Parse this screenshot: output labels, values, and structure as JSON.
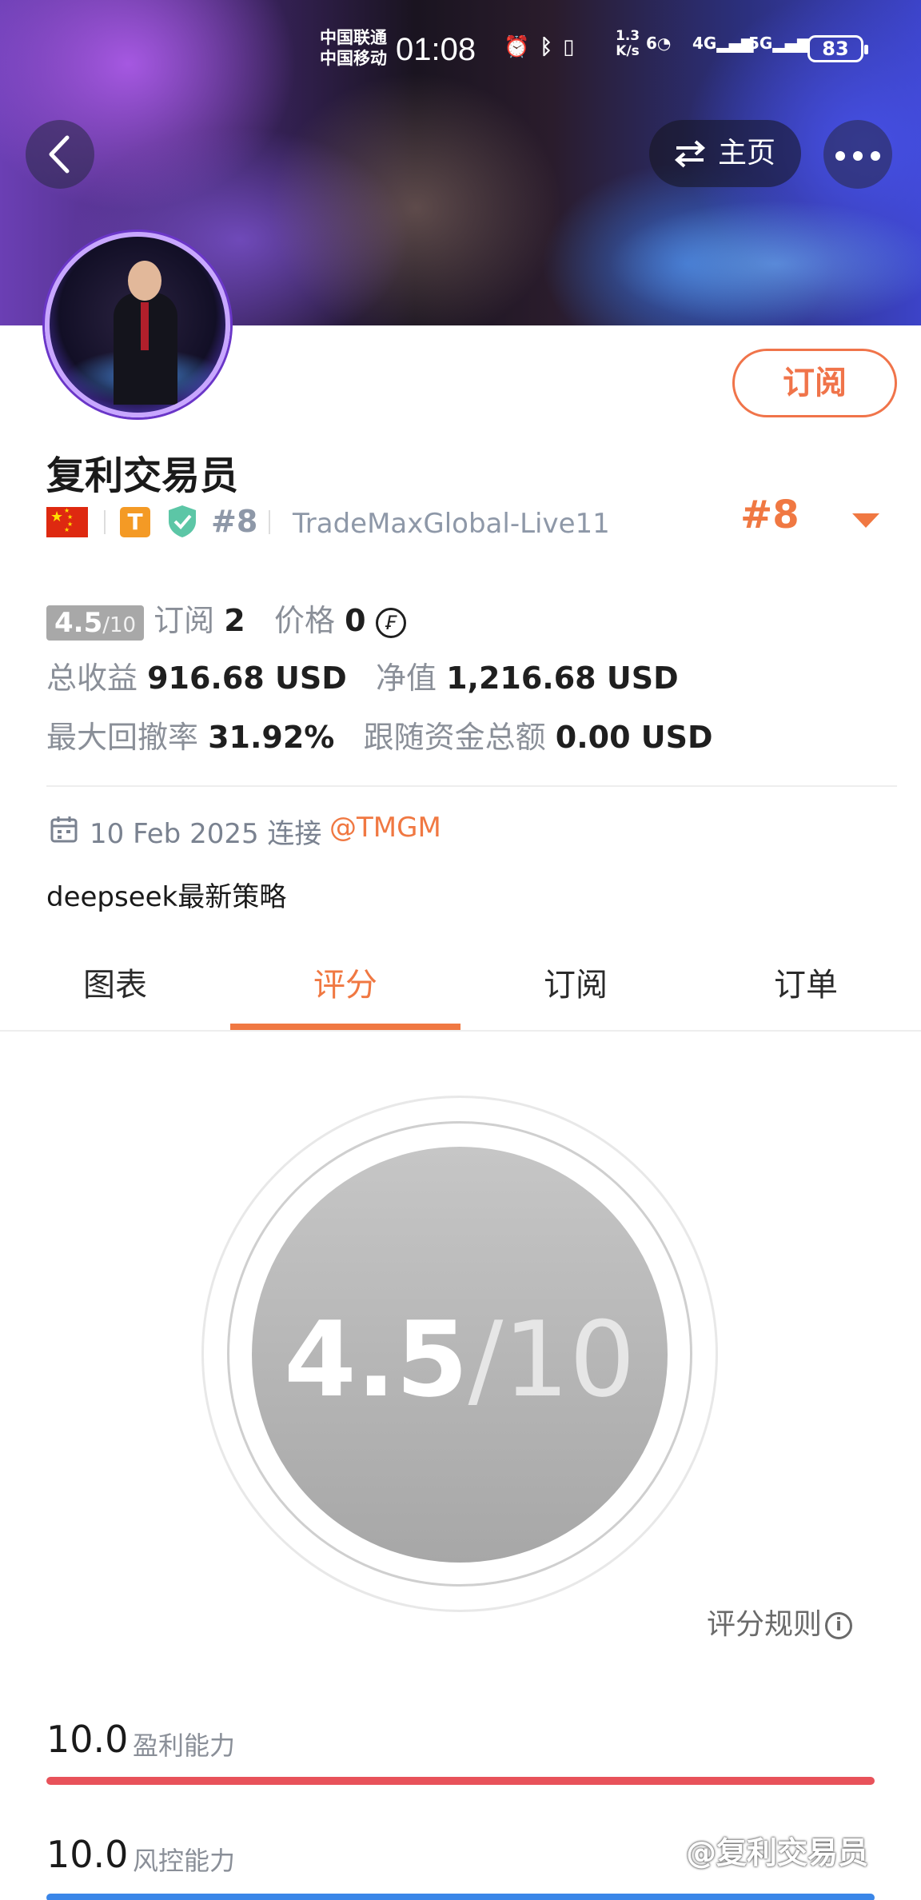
{
  "status_bar": {
    "carrier_1": "中国联通",
    "carrier_2": "中国移动",
    "time": "01:08",
    "speed_value": "1.3",
    "speed_unit": "K/s",
    "wifi_label": "6",
    "net_1": "4G",
    "net_2": "5G",
    "battery": "83"
  },
  "header": {
    "home_label": "主页",
    "subscribe_label": "订阅"
  },
  "profile": {
    "name": "复利交易员",
    "badge_letter": "T",
    "rank_inline": "#8",
    "server": "TradeMaxGlobal-Live11",
    "rank_right": "#8"
  },
  "stats": {
    "score_main": "4.5",
    "score_total": "/10",
    "subscriptions_label": "订阅",
    "subscriptions_value": "2",
    "price_label": "价格",
    "price_value": "0",
    "total_profit_label": "总收益",
    "total_profit_value": "916.68 USD",
    "net_value_label": "净值",
    "net_value_value": "1,216.68 USD",
    "max_drawdown_label": "最大回撤率",
    "max_drawdown_value": "31.92%",
    "follow_funds_label": "跟随资金总额",
    "follow_funds_value": "0.00 USD"
  },
  "connection": {
    "date_text": "10 Feb 2025 连接",
    "broker": "@TMGM"
  },
  "description": "deepseek最新策略",
  "tabs": [
    {
      "label": "图表"
    },
    {
      "label": "评分"
    },
    {
      "label": "订阅"
    },
    {
      "label": "订单"
    }
  ],
  "active_tab": "评分",
  "score_panel": {
    "score": "4.5",
    "out_of": "/10",
    "rules_label": "评分规则"
  },
  "metrics": [
    {
      "value": "10.0",
      "label": "盈利能力",
      "fraction": 1.0,
      "color": "#e8525a"
    },
    {
      "value": "10.0",
      "label": "风控能力",
      "fraction": 1.0,
      "color": "#3a86e8"
    }
  ],
  "watermark": "@复利交易员",
  "colors": {
    "accent": "#f07842",
    "score_grey": "#a8a8a8"
  }
}
